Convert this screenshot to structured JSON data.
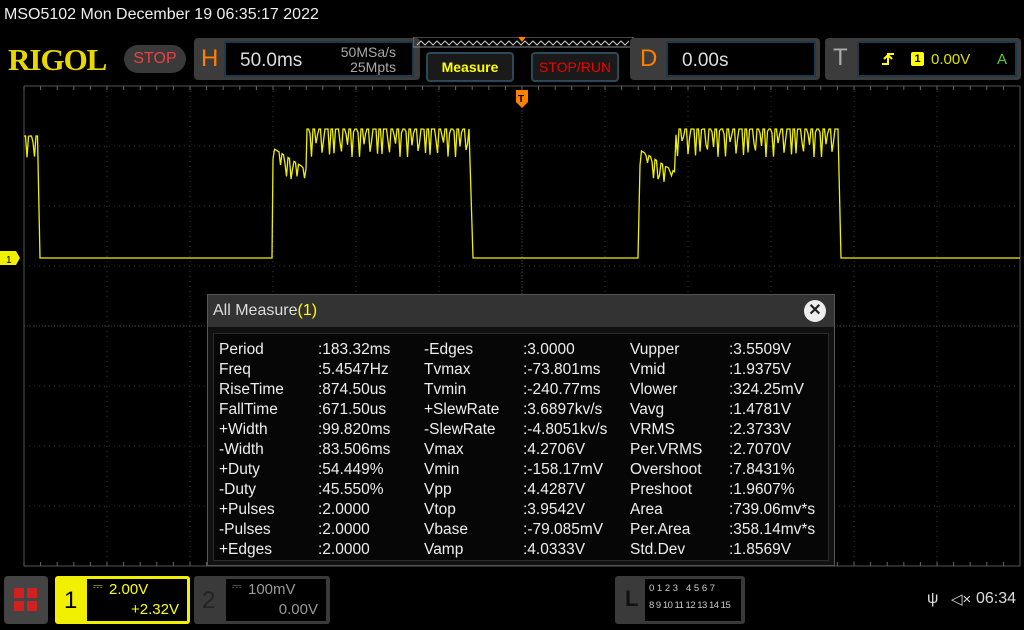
{
  "header": {
    "title": "MSO5102  Mon December 19 06:35:17 2022",
    "logo": "RIGOL",
    "run_state": "STOP"
  },
  "horizontal": {
    "label": "H",
    "timebase": "50.0ms",
    "sample_rate": "50MSa/s",
    "memory_depth": "25Mpts"
  },
  "buttons": {
    "measure": "Measure",
    "stop_run": "STOP/RUN"
  },
  "delay": {
    "label": "D",
    "value": "0.00s"
  },
  "trigger": {
    "label": "T",
    "slope_icon": "rising-edge-icon",
    "source": "1",
    "level": "0.00V",
    "mode": "A"
  },
  "channel_marker": "1",
  "colors": {
    "ch1": "#f0f000",
    "orange": "#ff8000",
    "stop": "#f04040"
  },
  "measure_dialog": {
    "title": "All Measure",
    "channel": "(1)",
    "columns": [
      [
        [
          "Period",
          ":183.32ms"
        ],
        [
          "Freq",
          ":5.4547Hz"
        ],
        [
          "RiseTime",
          ":874.50us"
        ],
        [
          "FallTime",
          ":671.50us"
        ],
        [
          "+Width",
          ":99.820ms"
        ],
        [
          "-Width",
          ":83.506ms"
        ],
        [
          "+Duty",
          ":54.449%"
        ],
        [
          "-Duty",
          ":45.550%"
        ],
        [
          "+Pulses",
          ":2.0000"
        ],
        [
          "-Pulses",
          ":2.0000"
        ],
        [
          "+Edges",
          ":2.0000"
        ]
      ],
      [
        [
          "-Edges",
          ":3.0000"
        ],
        [
          "Tvmax",
          ":-73.801ms"
        ],
        [
          "Tvmin",
          ":-240.77ms"
        ],
        [
          "+SlewRate",
          ":3.6897kv/s"
        ],
        [
          "-SlewRate",
          ":-4.8051kv/s"
        ],
        [
          "Vmax",
          ":4.2706V"
        ],
        [
          "Vmin",
          ":-158.17mV"
        ],
        [
          "Vpp",
          ":4.4287V"
        ],
        [
          "Vtop",
          ":3.9542V"
        ],
        [
          "Vbase",
          ":-79.085mV"
        ],
        [
          "Vamp",
          ":4.0333V"
        ]
      ],
      [
        [
          "Vupper",
          ":3.5509V"
        ],
        [
          "Vmid",
          ":1.9375V"
        ],
        [
          "Vlower",
          ":324.25mV"
        ],
        [
          "Vavg",
          ":1.4781V"
        ],
        [
          "VRMS",
          ":2.3733V"
        ],
        [
          "Per.VRMS",
          ":2.7070V"
        ],
        [
          "Overshoot",
          ":7.8431%"
        ],
        [
          "Preshoot",
          ":1.9607%"
        ],
        [
          "Area",
          ":739.06mv*s"
        ],
        [
          "Per.Area",
          ":358.14mv*s"
        ],
        [
          "Std.Dev",
          ":1.8569V"
        ]
      ]
    ]
  },
  "ch1": {
    "num": "1",
    "scale": "2.00V",
    "offset": "+2.32V"
  },
  "ch2": {
    "num": "2",
    "scale": "100mV",
    "offset": "0.00V"
  },
  "logic": {
    "label": "L",
    "row1": "0 1 2 3   4 5 6 7",
    "row2": "8 9 10 11 12 13 14 15"
  },
  "status": {
    "time": "06:34"
  }
}
